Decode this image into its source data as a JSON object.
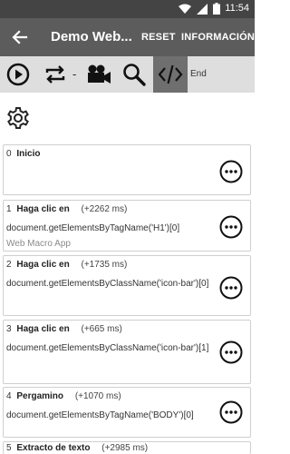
{
  "status_bar": {
    "time": "11:54"
  },
  "app_bar": {
    "title": "Demo Web...",
    "reset_label": "RESET",
    "info_label": "INFORMACIÓN"
  },
  "toolbar": {
    "separator": "-",
    "end_label": "End"
  },
  "steps": [
    {
      "index": "0",
      "action": "Inicio",
      "duration": "",
      "selector": "",
      "subtitle": ""
    },
    {
      "index": "1",
      "action": "Haga clic en",
      "duration": "(+2262 ms)",
      "selector": "document.getElementsByTagName('H1')[0]",
      "subtitle": "Web Macro App"
    },
    {
      "index": "2",
      "action": "Haga clic en",
      "duration": "(+1735 ms)",
      "selector": "document.getElementsByClassName('icon-bar')[0]",
      "subtitle": ""
    },
    {
      "index": "3",
      "action": "Haga clic en",
      "duration": "(+665 ms)",
      "selector": "document.getElementsByClassName('icon-bar')[1]",
      "subtitle": ""
    },
    {
      "index": "4",
      "action": "Pergamino",
      "duration": "(+1070 ms)",
      "selector": "document.getElementsByTagName('BODY')[0]",
      "subtitle": ""
    },
    {
      "index": "5",
      "action": "Extracto de texto",
      "duration": "(+2985 ms)",
      "selector": "",
      "subtitle": ""
    }
  ],
  "icons": {
    "back": "arrow-back-icon",
    "play": "play-icon",
    "repeat": "repeat-icon",
    "record": "video-camera-icon",
    "inspect": "search-icon",
    "code": "code-icon",
    "settings": "gear-icon",
    "more": "more-icon"
  }
}
